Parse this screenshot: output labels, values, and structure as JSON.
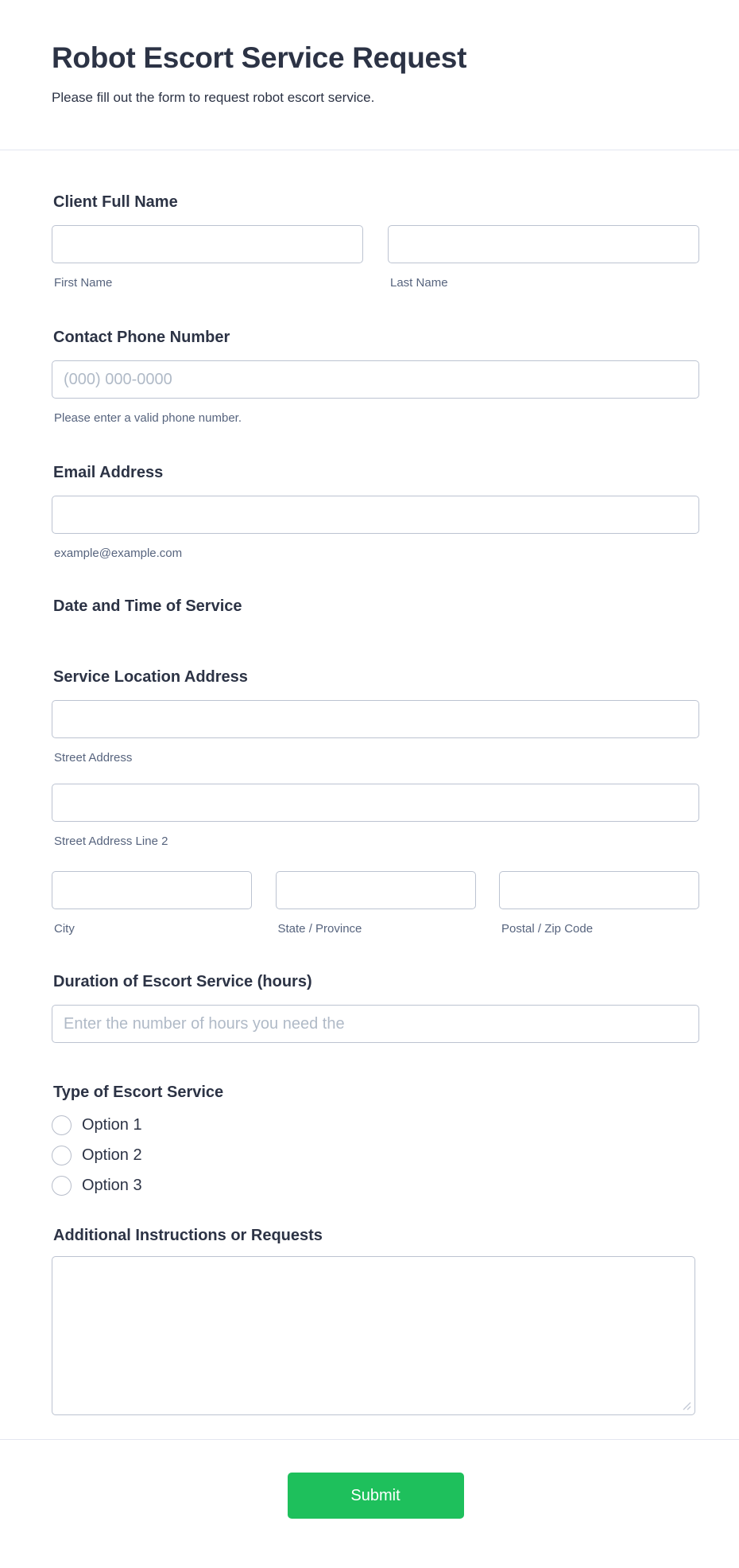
{
  "header": {
    "title": "Robot Escort Service Request",
    "subtitle": "Please fill out the form to request robot escort service."
  },
  "fields": {
    "full_name": {
      "label": "Client Full Name",
      "first_value": "",
      "first_sublabel": "First Name",
      "last_value": "",
      "last_sublabel": "Last Name"
    },
    "phone": {
      "label": "Contact Phone Number",
      "value": "",
      "placeholder": "(000) 000-0000",
      "sublabel": "Please enter a valid phone number."
    },
    "email": {
      "label": "Email Address",
      "value": "",
      "sublabel": "example@example.com"
    },
    "datetime": {
      "label": "Date and Time of Service"
    },
    "address": {
      "label": "Service Location Address",
      "street_value": "",
      "street_sublabel": "Street Address",
      "street2_value": "",
      "street2_sublabel": "Street Address Line 2",
      "city_value": "",
      "city_sublabel": "City",
      "state_value": "",
      "state_sublabel": "State / Province",
      "postal_value": "",
      "postal_sublabel": "Postal / Zip Code"
    },
    "duration": {
      "label": "Duration of Escort Service (hours)",
      "value": "",
      "placeholder": "Enter the number of hours you need the"
    },
    "service_type": {
      "label": "Type of Escort Service",
      "selected": null,
      "options": [
        "Option 1",
        "Option 2",
        "Option 3"
      ]
    },
    "instructions": {
      "label": "Additional Instructions or Requests",
      "value": ""
    }
  },
  "submit": {
    "label": "Submit"
  },
  "colors": {
    "accent_green": "#1EC05C",
    "label_text": "#2c3345",
    "sublabel_text": "#57647e",
    "input_border": "#bcc3d1",
    "placeholder": "#b0bac7",
    "divider": "#e3e6f0"
  }
}
